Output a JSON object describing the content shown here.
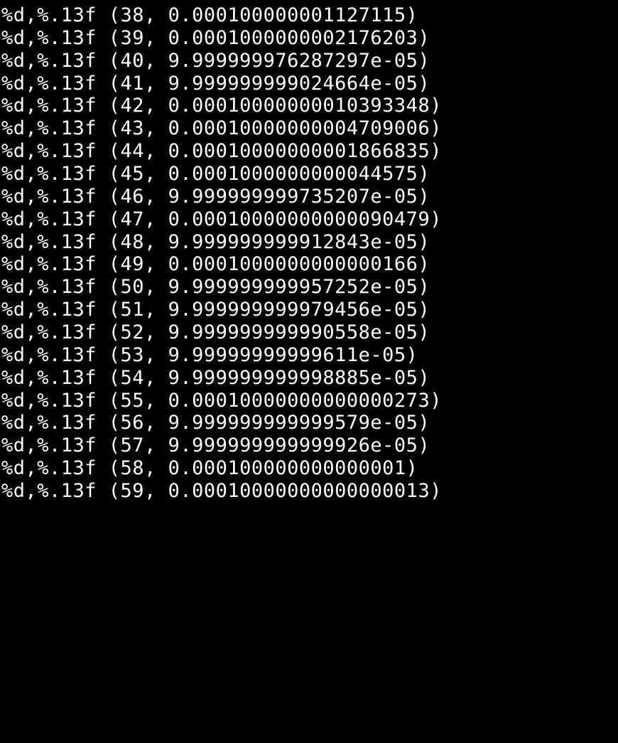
{
  "rows": [
    {
      "format": "%d,%.13f",
      "index": 38,
      "value": "0.000100000001127115"
    },
    {
      "format": "%d,%.13f",
      "index": 39,
      "value": "0.0001000000002176203"
    },
    {
      "format": "%d,%.13f",
      "index": 40,
      "value": "9.999999976287297e-05"
    },
    {
      "format": "%d,%.13f",
      "index": 41,
      "value": "9.999999999024664e-05"
    },
    {
      "format": "%d,%.13f",
      "index": 42,
      "value": "0.00010000000010393348"
    },
    {
      "format": "%d,%.13f",
      "index": 43,
      "value": "0.00010000000004709006"
    },
    {
      "format": "%d,%.13f",
      "index": 44,
      "value": "0.00010000000001866835"
    },
    {
      "format": "%d,%.13f",
      "index": 45,
      "value": "0.0001000000000044575"
    },
    {
      "format": "%d,%.13f",
      "index": 46,
      "value": "9.999999999735207e-05"
    },
    {
      "format": "%d,%.13f",
      "index": 47,
      "value": "0.00010000000000090479"
    },
    {
      "format": "%d,%.13f",
      "index": 48,
      "value": "9.999999999912843e-05"
    },
    {
      "format": "%d,%.13f",
      "index": 49,
      "value": "0.0001000000000000166"
    },
    {
      "format": "%d,%.13f",
      "index": 50,
      "value": "9.999999999957252e-05"
    },
    {
      "format": "%d,%.13f",
      "index": 51,
      "value": "9.999999999979456e-05"
    },
    {
      "format": "%d,%.13f",
      "index": 52,
      "value": "9.999999999990558e-05"
    },
    {
      "format": "%d,%.13f",
      "index": 53,
      "value": "9.99999999999611e-05"
    },
    {
      "format": "%d,%.13f",
      "index": 54,
      "value": "9.999999999998885e-05"
    },
    {
      "format": "%d,%.13f",
      "index": 55,
      "value": "0.00010000000000000273"
    },
    {
      "format": "%d,%.13f",
      "index": 56,
      "value": "9.999999999999579e-05"
    },
    {
      "format": "%d,%.13f",
      "index": 57,
      "value": "9.999999999999926e-05"
    },
    {
      "format": "%d,%.13f",
      "index": 58,
      "value": "0.000100000000000001"
    },
    {
      "format": "%d,%.13f",
      "index": 59,
      "value": "0.00010000000000000013"
    }
  ]
}
